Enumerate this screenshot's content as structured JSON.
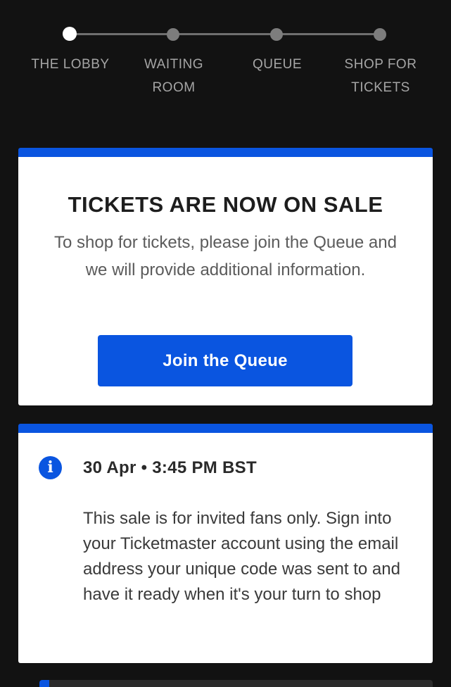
{
  "progress": {
    "steps": [
      {
        "label": "THE LOBBY",
        "state": "active"
      },
      {
        "label": "WAITING ROOM",
        "state": "upcoming"
      },
      {
        "label": "QUEUE",
        "state": "upcoming"
      },
      {
        "label": "SHOP FOR TICKETS",
        "state": "upcoming"
      }
    ]
  },
  "sale_card": {
    "title": "TICKETS ARE NOW ON SALE",
    "description": "To shop for tickets, please join the Queue and we will provide additional information.",
    "button_label": "Join the Queue"
  },
  "info_card": {
    "icon": "info-icon",
    "icon_glyph": "i",
    "datetime": "30 Apr • 3:45 PM BST",
    "body": "This sale is for invited fans only. Sign into your Ticketmaster account using the email address your unique code was sent to and have it ready when it's your turn to shop"
  },
  "colors": {
    "background": "#121212",
    "accent_blue": "#0a55e0",
    "card_background": "#ffffff",
    "step_inactive": "#7d7d7d",
    "step_active": "#ffffff",
    "step_label": "#a5a5a5"
  }
}
